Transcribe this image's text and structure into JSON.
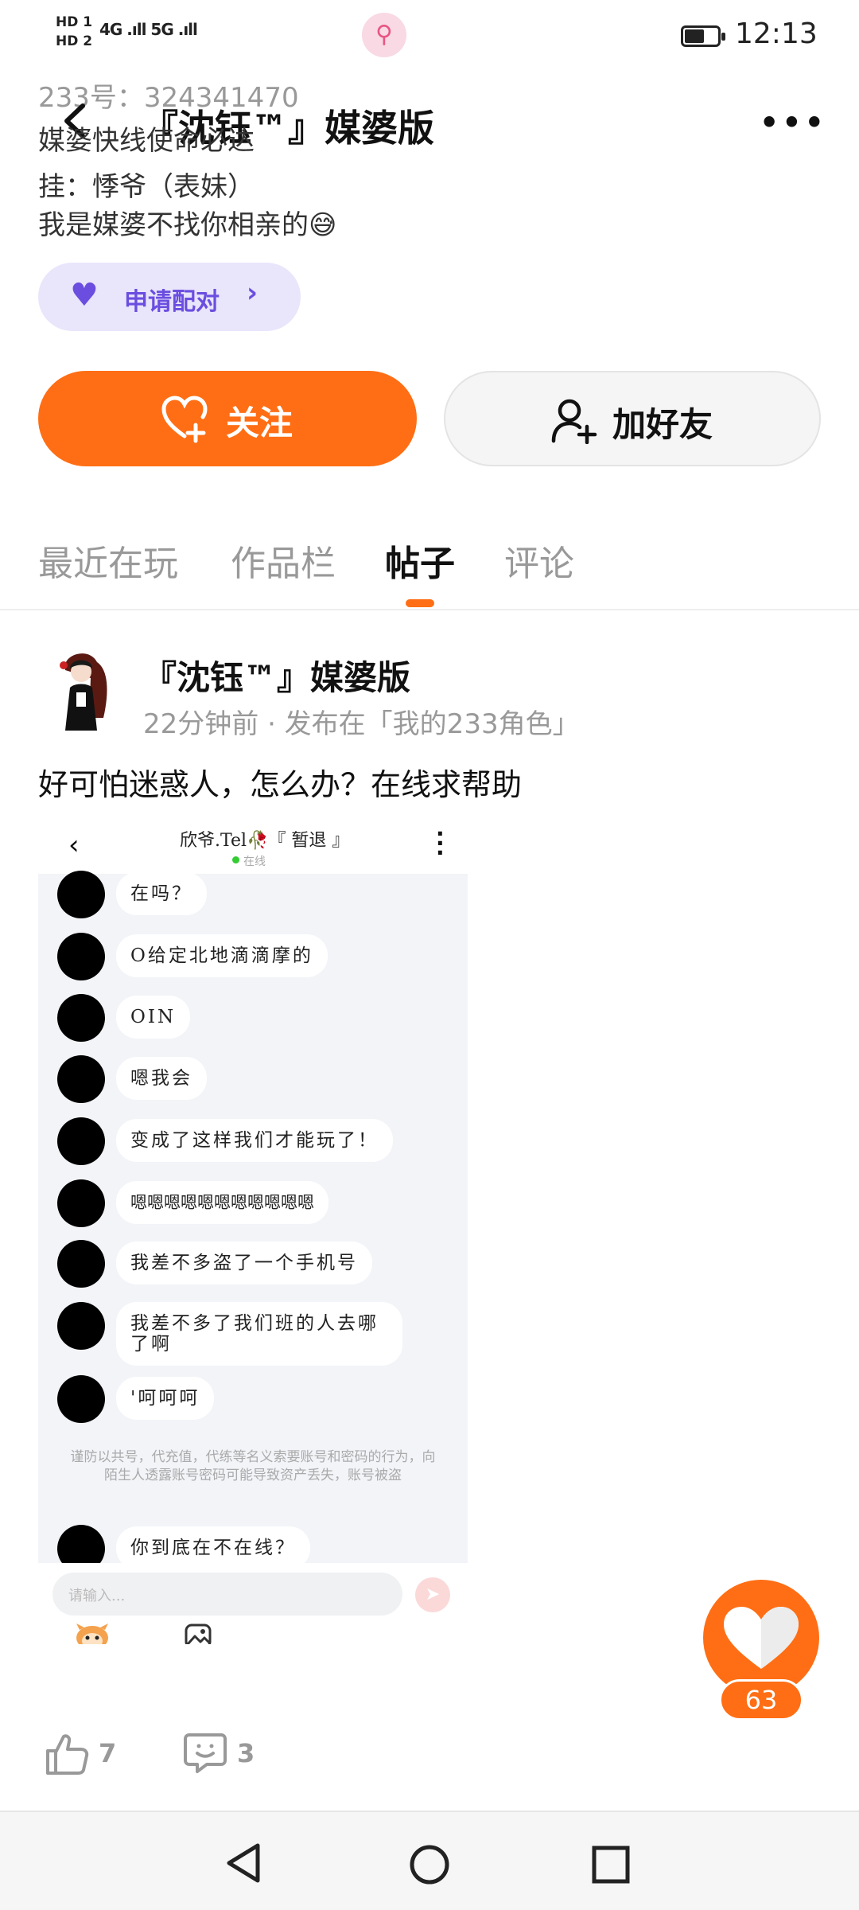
{
  "status_bar": {
    "sim1": "HD 1",
    "sim2": "HD 2",
    "signal": "4G .ıll 5G .ıll",
    "time": "12:13"
  },
  "header": {
    "ghost_id": "233号：324341470",
    "title": "『沈钰™』媒婆版",
    "more": "•••"
  },
  "bio": {
    "line1": "媒婆快线使命必达",
    "line2": "挂：悸爷（表妹）",
    "line3": "我是媒婆不找你相亲的😅"
  },
  "pair_button": {
    "label": "申请配对",
    "chevron": "›"
  },
  "follow_button": {
    "label": "关注"
  },
  "add_friend_button": {
    "label": "加好友"
  },
  "tabs": [
    {
      "label": "最近在玩"
    },
    {
      "label": "作品栏"
    },
    {
      "label": "帖子"
    },
    {
      "label": "评论"
    }
  ],
  "post": {
    "author": "『沈钰™』媒婆版",
    "meta": "22分钟前 · 发布在「我的233角色」",
    "text": "好可怕迷惑人，怎么办？在线求帮助",
    "likes": "7",
    "comments": "3"
  },
  "screenshot": {
    "title": "欣爷.Tel🥀『 暂退 』",
    "status": "在线",
    "messages": [
      "在吗？",
      "O给定北地滴滴摩的",
      "OIN",
      "嗯我会",
      "变成了这样我们才能玩了！",
      "嗯嗯嗯嗯嗯嗯嗯嗯嗯嗯嗯",
      "我差不多盗了一个手机号",
      "我差不多了我们班的人去哪了啊",
      "'呵呵呵"
    ],
    "warning": "谨防以共号，代充值，代练等名义索要账号和密码的行为，向陌生人透露账号密码可能导致资产丢失，账号被盗",
    "last_message": "你到底在不在线？",
    "input_placeholder": "请输入..."
  },
  "fab": {
    "count": "63"
  },
  "colors": {
    "accent": "#ff6e14",
    "pair": "#6b4ee0",
    "pair_bg": "#e9e5fb"
  }
}
